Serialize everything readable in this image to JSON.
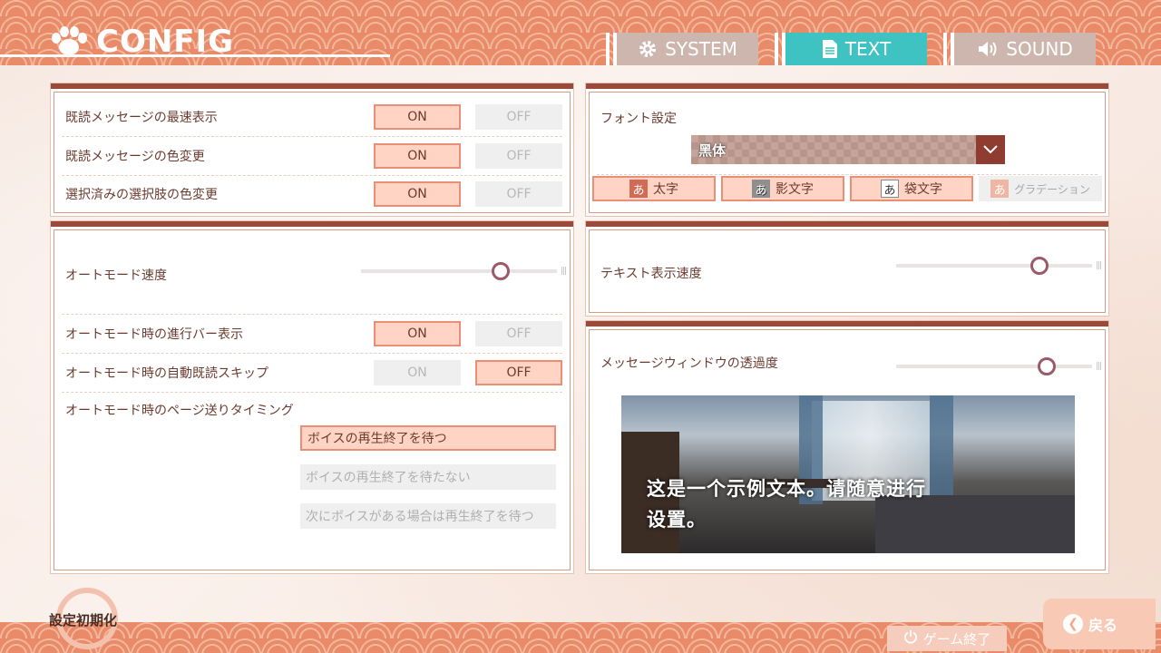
{
  "header": {
    "title": "CONFIG",
    "tabs": [
      {
        "label": "SYSTEM",
        "icon": "gear-icon",
        "active": false
      },
      {
        "label": "TEXT",
        "icon": "document-icon",
        "active": true
      },
      {
        "label": "SOUND",
        "icon": "speaker-icon",
        "active": false
      }
    ]
  },
  "read_panel": {
    "rows": [
      {
        "label": "既読メッセージの最速表示",
        "on": "ON",
        "off": "OFF",
        "selected": "on"
      },
      {
        "label": "既読メッセージの色変更",
        "on": "ON",
        "off": "OFF",
        "selected": "on"
      },
      {
        "label": "選択済みの選択肢の色変更",
        "on": "ON",
        "off": "OFF",
        "selected": "on"
      }
    ]
  },
  "auto_panel": {
    "speed_label": "オートモード速度",
    "speed_value": 0.7,
    "progress_bar": {
      "label": "オートモード時の進行バー表示",
      "on": "ON",
      "off": "OFF",
      "selected": "on"
    },
    "skip_read": {
      "label": "オートモード時の自動既読スキップ",
      "on": "ON",
      "off": "OFF",
      "selected": "off"
    },
    "timing_label": "オートモード時のページ送りタイミング",
    "timing_options": [
      {
        "label": "ボイスの再生終了を待つ",
        "selected": true
      },
      {
        "label": "ボイスの再生終了を待たない",
        "selected": false
      },
      {
        "label": "次にボイスがある場合は再生終了を待つ",
        "selected": false
      }
    ]
  },
  "font_panel": {
    "label": "フォント設定",
    "selected_font": "黑体",
    "styles": [
      {
        "glyph": "あ",
        "label": "太字",
        "selected": true
      },
      {
        "glyph": "あ",
        "label": "影文字",
        "selected": true
      },
      {
        "glyph": "あ",
        "label": "袋文字",
        "selected": true
      },
      {
        "glyph": "あ",
        "label": "グラデーション",
        "selected": false
      }
    ]
  },
  "text_speed_panel": {
    "label": "テキスト表示速度",
    "value": 0.72
  },
  "window_panel": {
    "label": "メッセージウィンドウの透過度",
    "value": 0.76,
    "preview_text_line1": "这是一个示例文本。请随意进行",
    "preview_text_line2": "设置。"
  },
  "footer": {
    "reset_label": "設定初期化",
    "quit_label": "ゲーム終了",
    "back_label": "戻る"
  }
}
